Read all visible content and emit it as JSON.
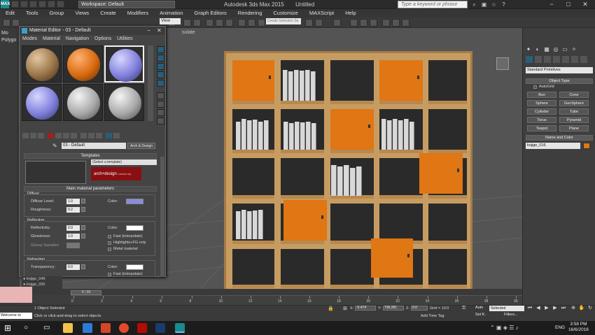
{
  "titlebar": {
    "app_title": "Autodesk 3ds Max  2015",
    "file_title": "Untitled",
    "workspace": "Workspace: Default",
    "search_placeholder": "Type a keyword or phrase",
    "logo": "MAX"
  },
  "menubar": [
    "Edit",
    "Tools",
    "Group",
    "Views",
    "Create",
    "Modifiers",
    "Animation",
    "Graph Editors",
    "Rendering",
    "Customize",
    "MAXScript",
    "Help"
  ],
  "toolbar": {
    "view_dropdown": "View",
    "selection_set": "Create Selection Se"
  },
  "left_ribbon": {
    "tab1": "Mo",
    "tab2": "Polygo"
  },
  "viewport": {
    "label_fragment": "sulate"
  },
  "material_editor": {
    "title": "Material Editor - 03 - Default",
    "menu": [
      "Modes",
      "Material",
      "Navigation",
      "Options",
      "Utilities"
    ],
    "slots": [
      {
        "kind": "wood",
        "selected": false
      },
      {
        "kind": "orange",
        "selected": false
      },
      {
        "kind": "blue",
        "selected": true
      },
      {
        "kind": "blue",
        "selected": false
      },
      {
        "kind": "gray",
        "selected": false
      },
      {
        "kind": "gray",
        "selected": false
      }
    ],
    "material_name": "03 - Default",
    "arch_design_button": "Arch & Design",
    "templates_header": "Templates",
    "template_select": "(Select a template)",
    "template_logo": "arch+design",
    "template_logo_sub": "mental ray",
    "main_params_header": "Main material parameters",
    "diffuse": {
      "group": "Diffuse",
      "diffuse_level_label": "Diffuse Level:",
      "diffuse_level": "1.0",
      "roughness_label": "Roughness:",
      "roughness": "0.2",
      "color_label": "Color:",
      "color": "#8b8be0"
    },
    "reflection": {
      "group": "Reflection",
      "reflectivity_label": "Reflectivity:",
      "reflectivity": "0.0",
      "glossiness_label": "Glossiness:",
      "glossiness": "1.0",
      "glossy_samples_label": "Glossy Samples:",
      "glossy_samples": "8",
      "color_label": "Color:",
      "color": "#ffffff",
      "fast_interp": "Fast (interpolate)",
      "highlights_fg": "Highlights+FG only",
      "metal": "Metal material"
    },
    "refraction": {
      "group": "Refraction",
      "transparency_label": "Transparency:",
      "transparency": "0.0",
      "color_label": "Color:",
      "color": "#ffffff",
      "fast_interp": "Fast (interpolate)"
    }
  },
  "command_panel": {
    "category": "Standard Primitives",
    "object_type_header": "Object Type",
    "autogrid": "AutoGrid",
    "buttons": [
      "Box",
      "Cone",
      "Sphere",
      "GeoSphere",
      "Cylinder",
      "Tube",
      "Torus",
      "Pyramid",
      "Teapot",
      "Plane"
    ],
    "name_color_header": "Name and Color",
    "object_name": "knjige_016",
    "object_color": "#e07614"
  },
  "scene_list": [
    "knjige_049",
    "knjige_050"
  ],
  "timeline": {
    "slider": "0 / 30",
    "ticks": [
      0,
      2,
      4,
      6,
      8,
      10,
      12,
      14,
      16,
      18,
      20,
      22,
      24,
      26,
      28,
      30
    ]
  },
  "status": {
    "listener": "Welcome to",
    "selected": "1 Object Selected",
    "prompt": "Click or click-and-drag to select objects",
    "x_label": "X:",
    "x": "-5.474",
    "y_label": "Y:",
    "y": "736.281",
    "z_label": "Z:",
    "z": "0.0",
    "grid": "Grid = 10.0",
    "add_time_tag": "Add Time Tag",
    "auto": "Auto",
    "selected_dd": "Selected",
    "set_key": "Set K.",
    "filters": "Filters..."
  },
  "taskbar": {
    "time": "3:58 PM",
    "date": "16/6/2016",
    "lang": "ENG"
  }
}
